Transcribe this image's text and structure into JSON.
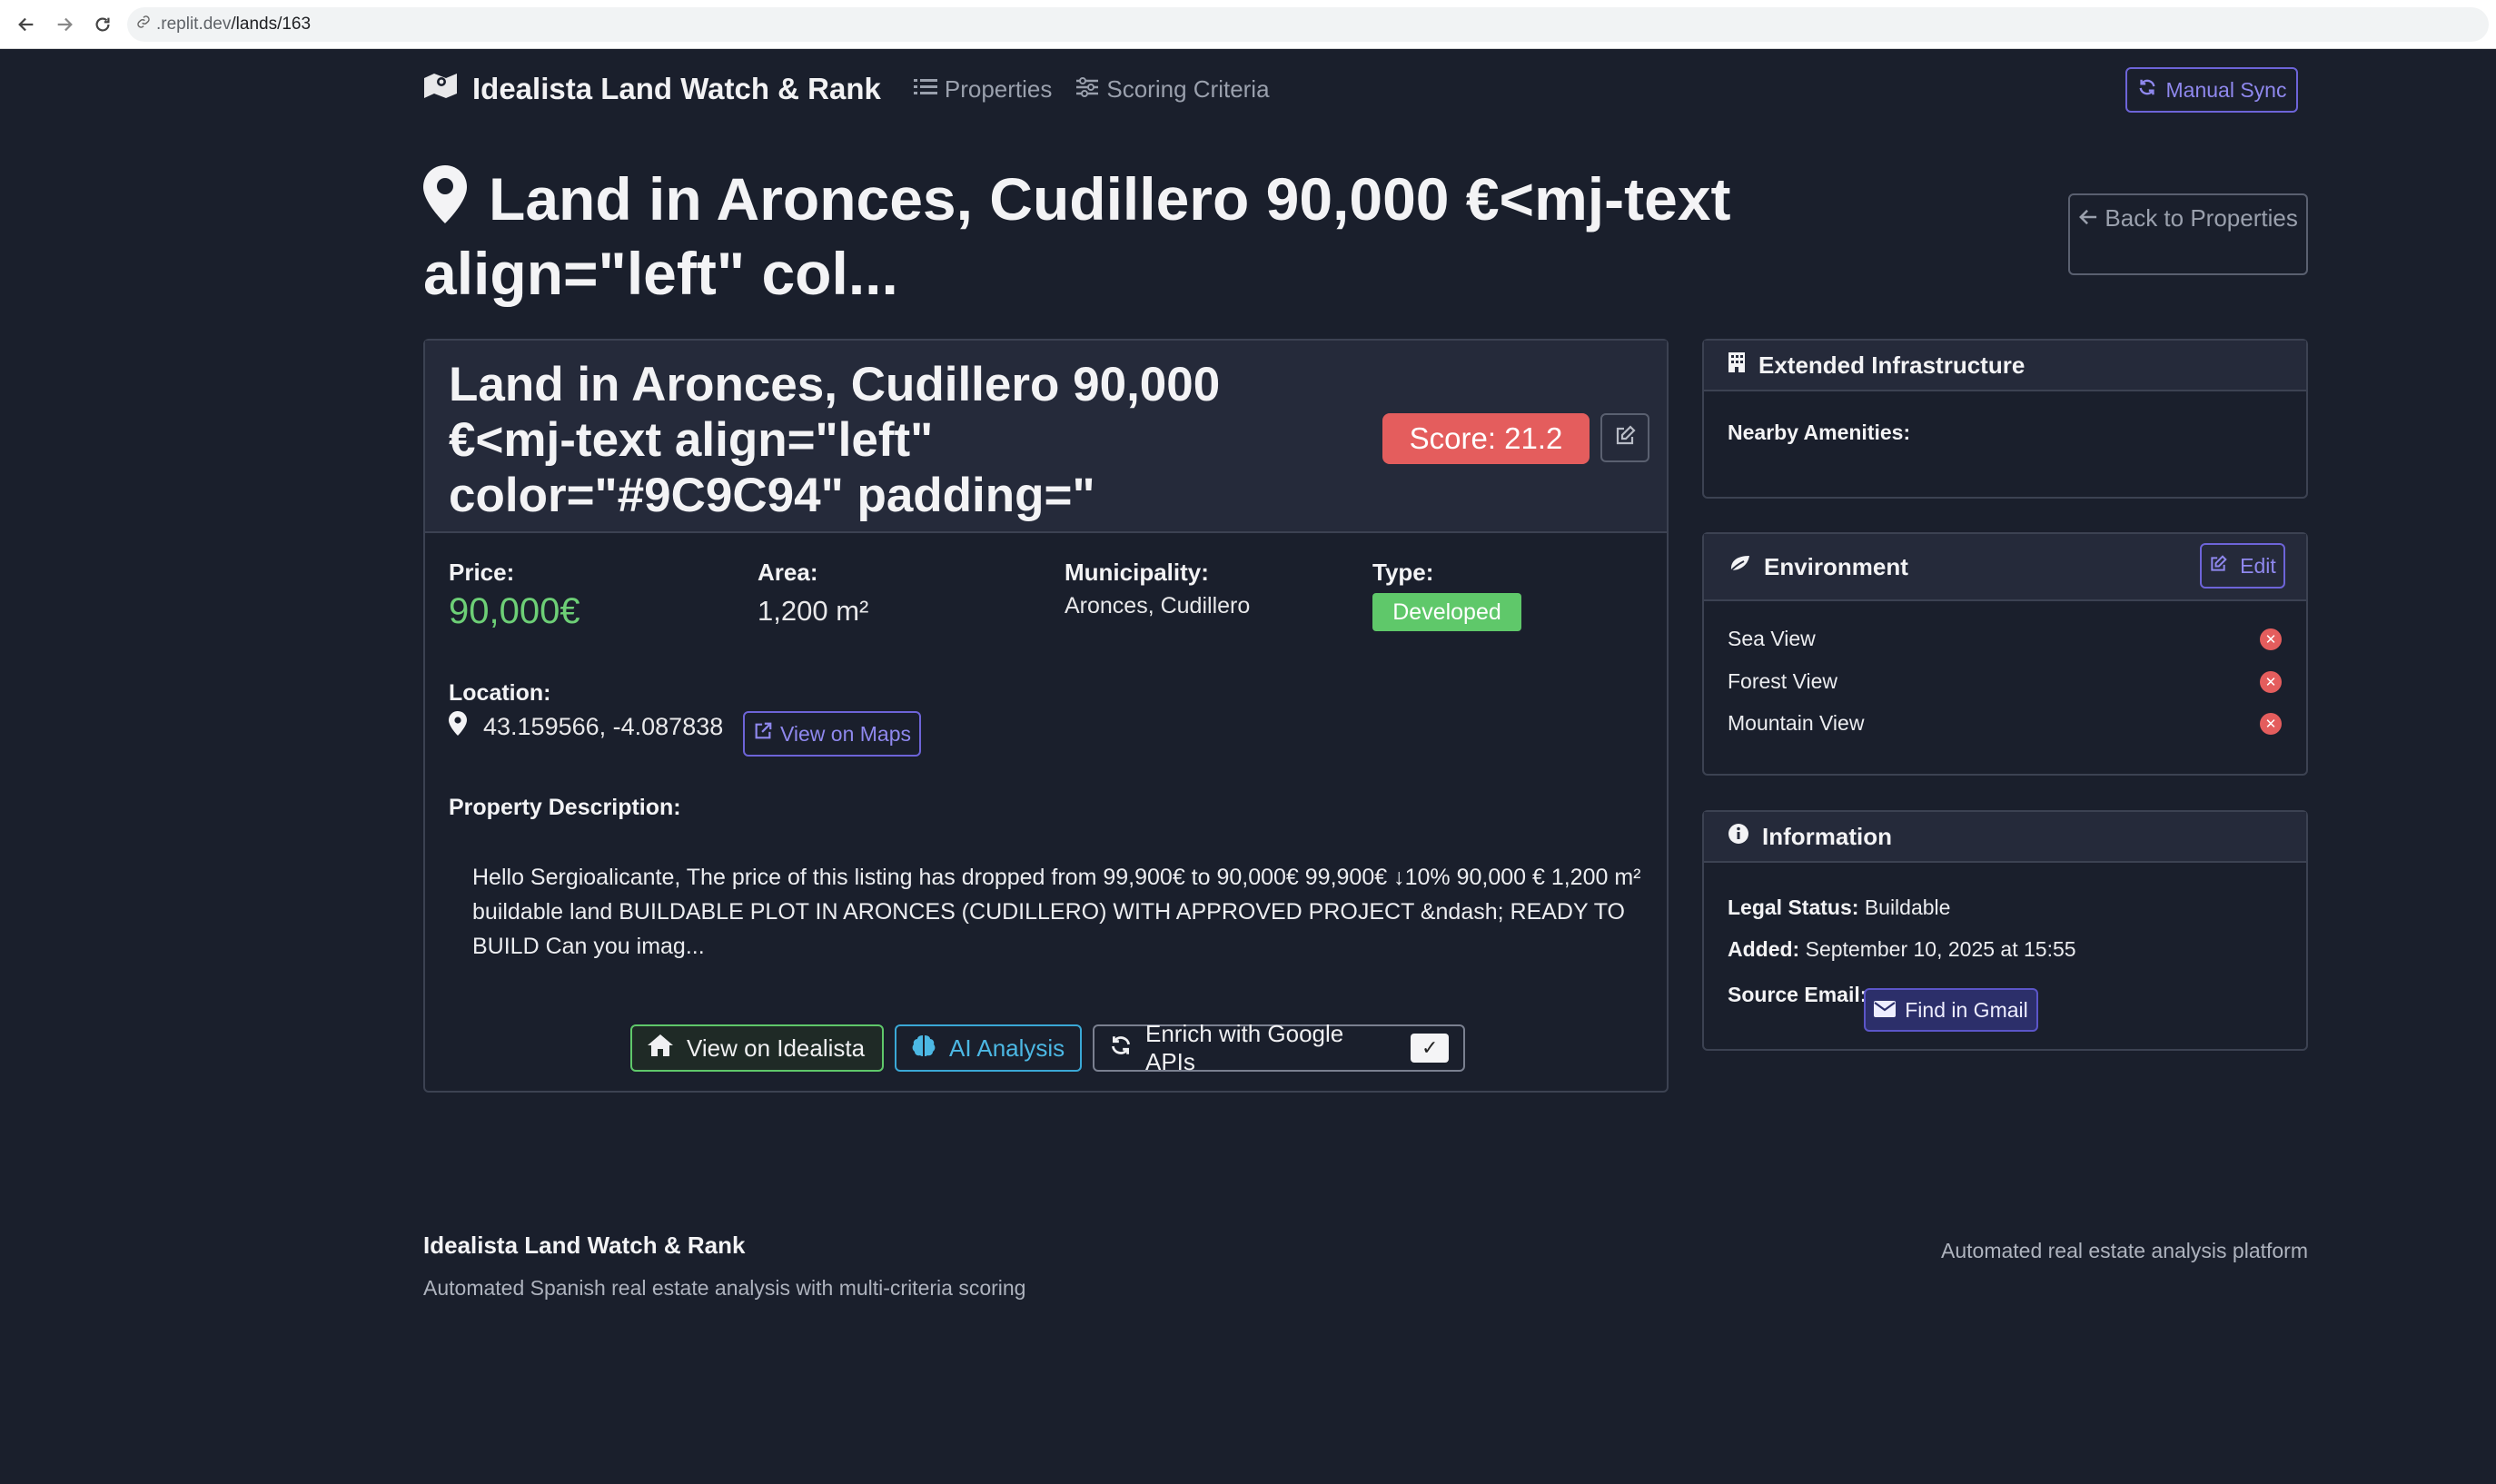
{
  "browser": {
    "url_prefix": ".replit.dev",
    "url_path": "/lands/163"
  },
  "navbar": {
    "brand": "Idealista Land Watch & Rank",
    "links": [
      "Properties",
      "Scoring Criteria"
    ],
    "sync_button": "Manual Sync"
  },
  "page": {
    "title": "Land in Aronces, Cudillero 90,000 €<mj-text align=\"left\" col...",
    "back_button": "Back to Properties"
  },
  "main_card": {
    "title": "Land in Aronces, Cudillero 90,000 €<mj-text align=\"left\" color=\"#9C9C94\" padding=\"",
    "score": "Score: 21.2",
    "price_label": "Price:",
    "price_value": "90,000€",
    "area_label": "Area:",
    "area_value": "1,200 m²",
    "municipality_label": "Municipality:",
    "municipality_value": "Aronces, Cudillero",
    "type_label": "Type:",
    "type_value": "Developed",
    "location_label": "Location:",
    "coordinates": "43.159566, -4.087838",
    "maps_button": "View on Maps",
    "description_label": "Property Description:",
    "description": "Hello Sergioalicante, The price of this listing has dropped from 99,900€ to 90,000€ 99,900€ ↓10% 90,000 € 1,200 m² buildable land BUILDABLE PLOT IN ARONCES (CUDILLERO) WITH APPROVED PROJECT &ndash; READY TO BUILD Can you imag...",
    "buttons": {
      "idealista": "View on Idealista",
      "ai": "AI Analysis",
      "enrich": "Enrich with Google APIs",
      "check": "✓"
    }
  },
  "infrastructure": {
    "title": "Extended Infrastructure",
    "amenities_label": "Nearby Amenities:"
  },
  "environment": {
    "title": "Environment",
    "edit_button": "Edit",
    "items": [
      "Sea View",
      "Forest View",
      "Mountain View"
    ]
  },
  "information": {
    "title": "Information",
    "legal_label": "Legal Status:",
    "legal_value": "Buildable",
    "added_label": "Added:",
    "added_value": "September 10, 2025 at 15:55",
    "email_label": "Source Email:",
    "gmail_button": "Find in Gmail"
  },
  "footer": {
    "title": "Idealista Land Watch & Rank",
    "subtitle": "Automated Spanish real estate analysis with multi-criteria scoring",
    "right": "Automated real estate analysis platform"
  },
  "colors": {
    "background": "#1a1f2c",
    "card_header": "#252a3a",
    "accent": "#6d64d8",
    "price": "#6dcf76",
    "score": "#e45d5d",
    "developed_badge": "#5fc86a"
  }
}
